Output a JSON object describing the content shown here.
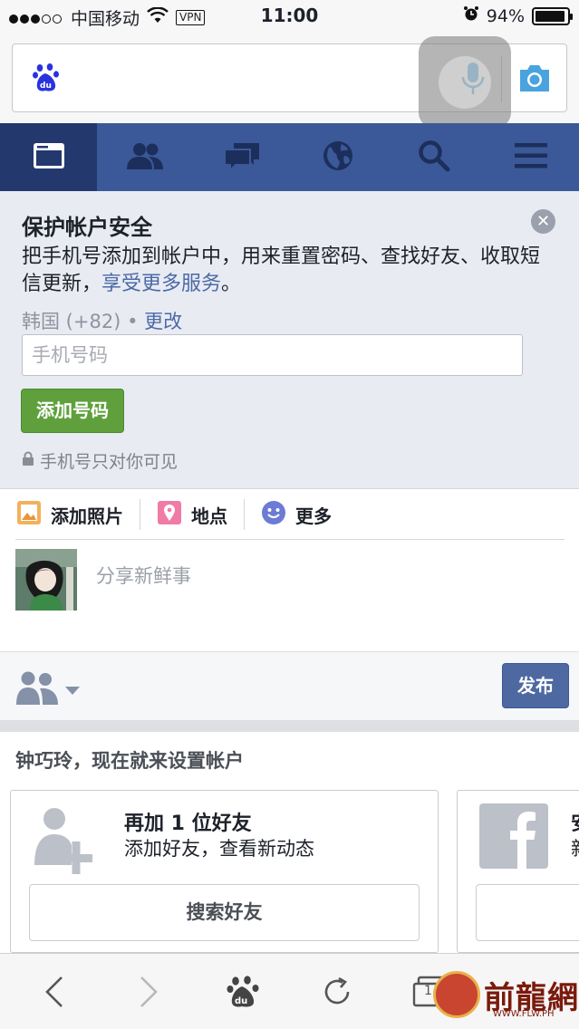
{
  "status_bar": {
    "carrier": "中国移动",
    "vpn": "VPN",
    "time": "11:00",
    "battery": "94%",
    "battery_level": 0.94
  },
  "nav": {
    "items": [
      "news-feed-icon",
      "friends-icon",
      "messages-icon",
      "notifications-globe-icon",
      "search-icon",
      "menu-icon"
    ],
    "active_index": 0,
    "bg_color": "#3b5998",
    "active_color": "#23386d"
  },
  "security": {
    "title": "保护帐户安全",
    "description": "把手机号添加到帐户中，用来重置密码、查找好友、收取短信更新，",
    "link": "享受更多服务",
    "description_end": "。",
    "country": "韩国 (+82)",
    "dot": " • ",
    "change": "更改",
    "phone_placeholder": "手机号码",
    "add_button": "添加号码",
    "privacy_note": "手机号只对你可见"
  },
  "composer": {
    "add_photo": "添加照片",
    "location": "地点",
    "more": "更多",
    "placeholder": "分享新鲜事",
    "publish": "发布"
  },
  "setup": {
    "title": "钟巧玲，现在就来设置帐户",
    "card1_title": "再加 1 位好友",
    "card1_sub": "添加好友，查看新动态",
    "card1_button": "搜索好友",
    "card2_title_partial": "安",
    "card2_sub_partial": "新"
  },
  "toolbar": {
    "tabs_count": "1"
  },
  "watermark": {
    "text": "前龍網",
    "url": "WWW.FLW.PH"
  }
}
